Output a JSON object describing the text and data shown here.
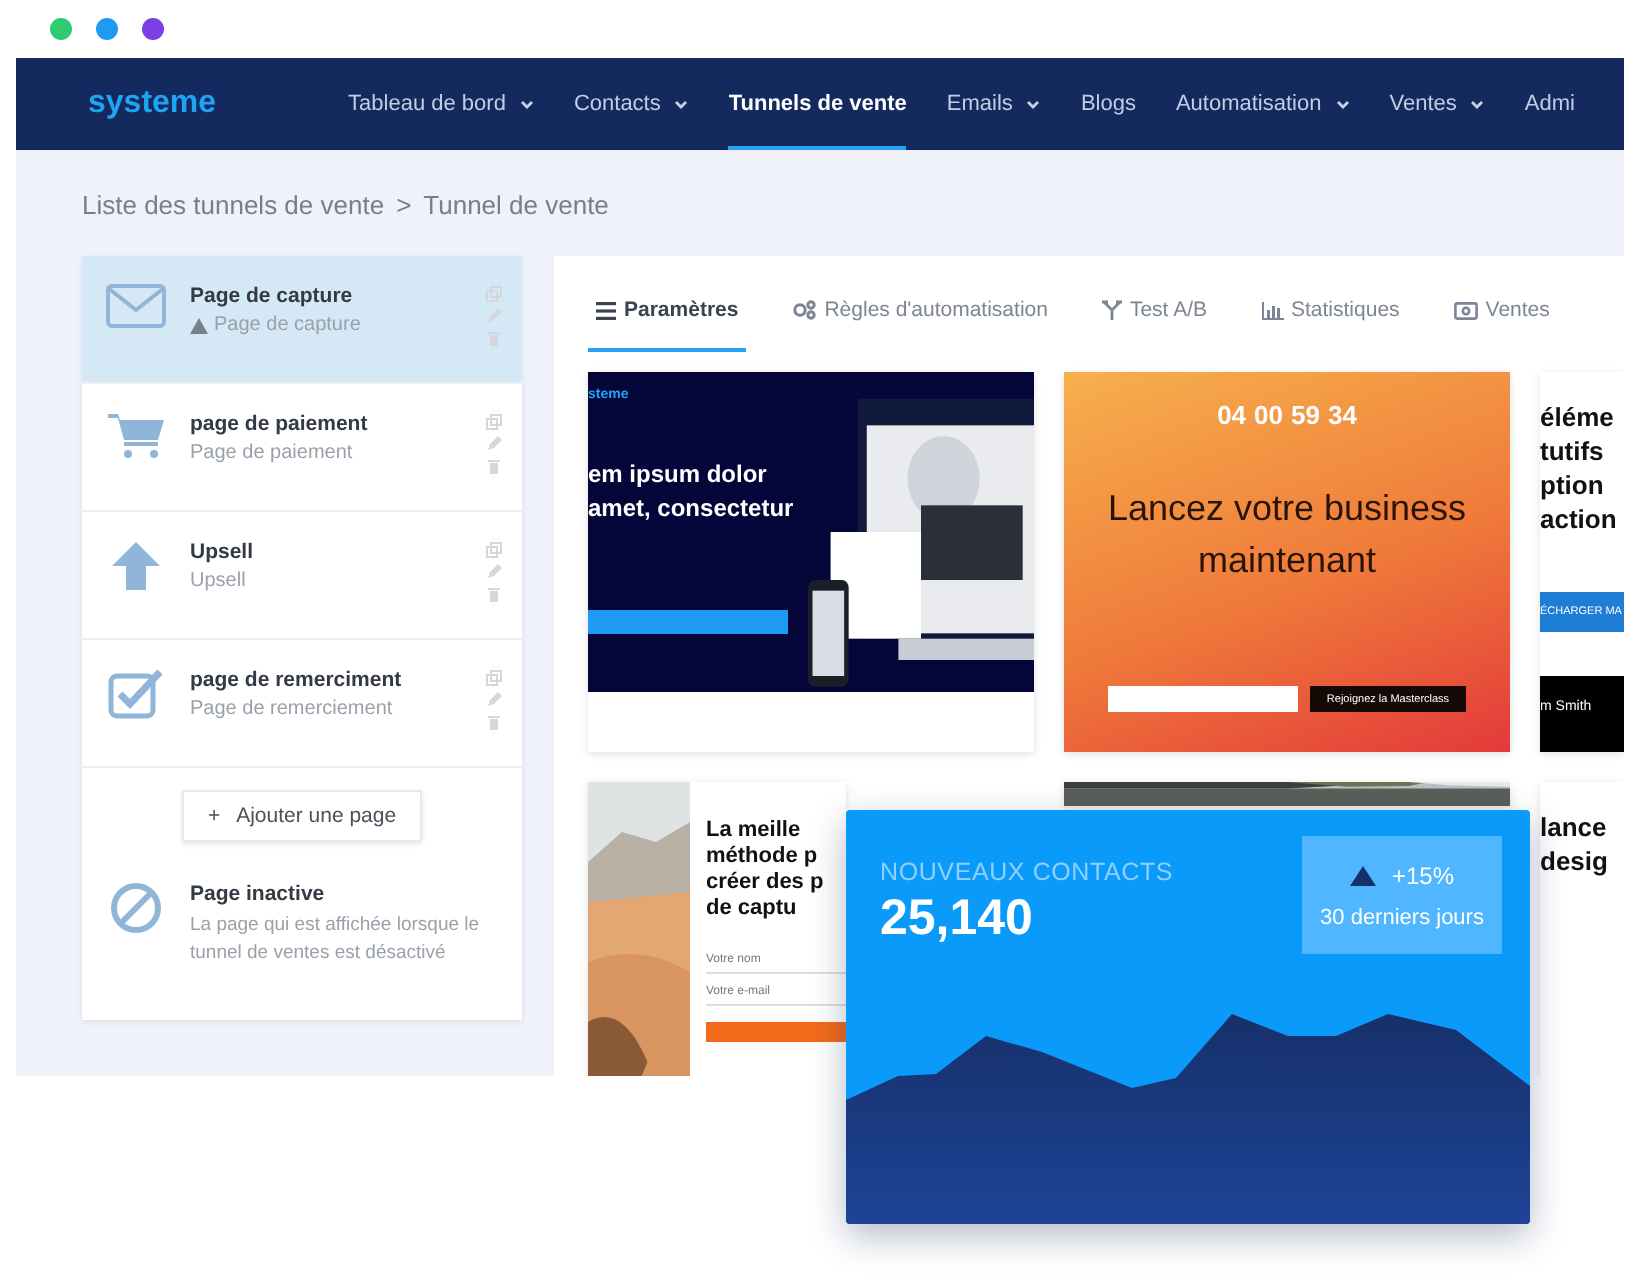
{
  "window_dots": [
    {
      "color": "#2ecc71"
    },
    {
      "color": "#1e9bf0"
    },
    {
      "color": "#7b3fe4"
    }
  ],
  "navbar": {
    "logo": "systeme",
    "items": [
      {
        "label": "Tableau de bord",
        "selected": false,
        "has_menu": true
      },
      {
        "label": "Contacts",
        "selected": false,
        "has_menu": true
      },
      {
        "label": "Tunnels de vente",
        "selected": true,
        "has_menu": false
      },
      {
        "label": "Emails",
        "selected": false,
        "has_menu": true
      },
      {
        "label": "Blogs",
        "selected": false,
        "has_menu": false
      },
      {
        "label": "Automatisation",
        "selected": false,
        "has_menu": true
      },
      {
        "label": "Ventes",
        "selected": false,
        "has_menu": true
      },
      {
        "label": "Admi",
        "selected": false,
        "has_menu": false
      }
    ]
  },
  "breadcrumb": {
    "items": [
      "Liste des tunnels de vente",
      "Tunnel de vente"
    ],
    "separator": ">"
  },
  "steps": [
    {
      "kind": "envelope",
      "title": "Page de capture",
      "subtitle": "Page de capture",
      "selected": true,
      "warning": true
    },
    {
      "kind": "cart",
      "title": "page de paiement",
      "subtitle": "Page de paiement",
      "selected": false,
      "warning": false
    },
    {
      "kind": "arrow",
      "title": "Upsell",
      "subtitle": "Upsell",
      "selected": false,
      "warning": false
    },
    {
      "kind": "check",
      "title": "page de remerciment",
      "subtitle": "Page de remerciement",
      "selected": false,
      "warning": false
    }
  ],
  "add_page_button": {
    "icon": "+",
    "label": "Ajouter une page"
  },
  "inactive_page": {
    "title": "Page inactive",
    "description": "La page qui est affichée lorsque le tunnel de ventes est désactivé"
  },
  "tabs": [
    {
      "kind": "list",
      "label": "Paramètres",
      "selected": true
    },
    {
      "kind": "gears",
      "label": "Règles d'automatisation",
      "selected": false
    },
    {
      "kind": "split",
      "label": "Test A/B",
      "selected": false
    },
    {
      "kind": "bars",
      "label": "Statistiques",
      "selected": false
    },
    {
      "kind": "money",
      "label": "Ventes",
      "selected": false
    }
  ],
  "templates": [
    {
      "kind": "dark",
      "logo": "steme",
      "headline": [
        "em ipsum dolor",
        "amet, consectetur"
      ]
    },
    {
      "kind": "countdown",
      "timer": [
        "04",
        "00",
        "59",
        "34"
      ],
      "headline": "Lancez votre business maintenant",
      "button": "Rejoignez la Masterclass"
    },
    {
      "kind": "text",
      "lines": [
        "éléme",
        "tutifs",
        "ption",
        "action"
      ],
      "button": "ÉCHARGER MA",
      "footer": "m Smith"
    },
    {
      "kind": "form",
      "headline": [
        "La meille",
        "méthode p",
        "créer des p",
        "de captu"
      ],
      "fields": [
        "Votre nom",
        "Votre e-mail"
      ]
    },
    {
      "kind": "picture"
    },
    {
      "kind": "text",
      "lines": [
        "lance",
        "desig"
      ]
    }
  ],
  "stats_card": {
    "title": "NOUVEAUX CONTACTS",
    "value": "25,140",
    "trend_up": true,
    "change": "+15%",
    "period": "30 derniers jours"
  }
}
